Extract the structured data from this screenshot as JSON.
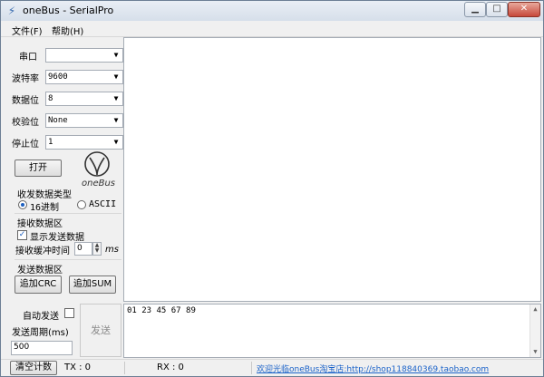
{
  "window": {
    "title": "oneBus - SerialPro",
    "app_icon": "plug-icon",
    "controls": [
      "minimize-icon",
      "maximize-icon",
      "close-icon"
    ]
  },
  "menu": {
    "items": [
      {
        "label": "文件(F)"
      },
      {
        "label": "帮助(H)"
      }
    ]
  },
  "settings": {
    "port": {
      "label": "串口",
      "value": ""
    },
    "baud": {
      "label": "波特率",
      "value": "9600"
    },
    "databits": {
      "label": "数据位",
      "value": "8"
    },
    "parity": {
      "label": "校验位",
      "value": "None"
    },
    "stopbits": {
      "label": "停止位",
      "value": "1"
    },
    "open_button": "打开",
    "logo_text": "oneBus"
  },
  "data_type": {
    "title": "收发数据类型",
    "options": [
      {
        "label": "16进制",
        "selected": true
      },
      {
        "label": "ASCII",
        "selected": false
      }
    ]
  },
  "receive": {
    "title": "接收数据区",
    "show_sent": {
      "label": "显示发送数据",
      "checked": true
    },
    "buffer": {
      "label": "接收缓冲时间",
      "value": "0",
      "unit": "ms"
    },
    "content": ""
  },
  "send": {
    "title": "发送数据区",
    "add_crc": "追加CRC",
    "add_sum": "追加SUM",
    "auto_send": {
      "label": "自动发送",
      "checked": false
    },
    "period": {
      "label": "发送周期(ms)",
      "value": "500"
    },
    "send_button": "发送",
    "content": "01 23 45 67 89"
  },
  "status": {
    "clear_button": "清空计数",
    "tx": "TX : 0",
    "rx": "RX : 0",
    "link": "欢迎光临oneBus淘宝店:http://shop118840369.taobao.com"
  },
  "colors": {
    "accent": "#1d5fbf",
    "link": "#1a62c9",
    "window_bg": "#f0f0f0"
  }
}
